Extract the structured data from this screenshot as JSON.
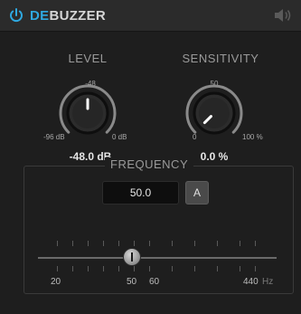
{
  "header": {
    "title_highlight": "DE",
    "title_rest": "BUZZER",
    "power_icon": "power-icon",
    "speaker_icon": "speaker-icon"
  },
  "level": {
    "label": "LEVEL",
    "top_mark": "-48",
    "min_label": "-96 dB",
    "max_label": "0 dB",
    "readout": "-48.0 dB",
    "fraction": 0.5
  },
  "sensitivity": {
    "label": "SENSITIVITY",
    "top_mark": "50",
    "min_label": "0",
    "max_label": "100 %",
    "readout": "0.0 %",
    "fraction": 0.0
  },
  "frequency": {
    "label": "FREQUENCY",
    "value": "50.0",
    "auto_button": "A",
    "scale": [
      "20",
      "50",
      "60",
      "440"
    ],
    "unit": "Hz"
  },
  "colors": {
    "accent": "#2fa8e0",
    "background": "#1e1e1e",
    "header": "#2b2b2b"
  }
}
